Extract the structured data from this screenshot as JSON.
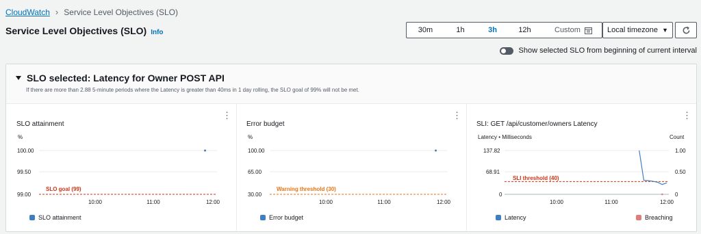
{
  "breadcrumb": {
    "root": "CloudWatch",
    "current": "Service Level Objectives (SLO)"
  },
  "header": {
    "title": "Service Level Objectives (SLO)",
    "info": "Info"
  },
  "time_range": {
    "options": [
      "30m",
      "1h",
      "3h",
      "12h"
    ],
    "active": "3h",
    "custom": "Custom",
    "timezone": "Local timezone"
  },
  "toggle": {
    "label": "Show selected SLO from beginning of current interval",
    "on": false
  },
  "slo": {
    "title": "SLO selected: Latency for Owner POST API",
    "description": "If there are more than 2.88 5-minute periods where the Latency is greater than 40ms in 1 day rolling, the SLO goal of 99% will not be met."
  },
  "panels": {
    "attainment": {
      "title": "SLO attainment",
      "unit": "%",
      "y_ticks": [
        "100.00",
        "99.50",
        "99.00"
      ],
      "x_ticks": [
        "10:00",
        "11:00",
        "12:00"
      ],
      "threshold_label": "SLO goal (99)",
      "legend": "SLO attainment"
    },
    "budget": {
      "title": "Error budget",
      "unit": "%",
      "y_ticks": [
        "100.00",
        "65.00",
        "30.00"
      ],
      "x_ticks": [
        "10:00",
        "11:00",
        "12:00"
      ],
      "threshold_label": "Warning threshold (30)",
      "legend": "Error budget"
    },
    "sli": {
      "title": "SLI: GET /api/customer/owners Latency",
      "left_unit": "Latency • Milliseconds",
      "right_unit": "Count",
      "y_ticks_left": [
        "137.82",
        "68.91",
        "0"
      ],
      "y_ticks_right": [
        "1.00",
        "0.50",
        "0"
      ],
      "x_ticks": [
        "10:00",
        "11:00",
        "12:00"
      ],
      "threshold_label": "SLI threshold (40)",
      "legend_latency": "Latency",
      "legend_breaching": "Breaching"
    }
  },
  "colors": {
    "link": "#0073bb",
    "series_blue": "#3f7fc1",
    "threshold_red": "#d13212",
    "threshold_orange": "#ec7211",
    "breaching": "#e07c7c"
  },
  "chart_data": [
    {
      "type": "scatter",
      "title": "SLO attainment",
      "ylabel": "%",
      "x": [
        "11:52"
      ],
      "values": [
        100.0
      ],
      "ylim": [
        99.0,
        100.0
      ],
      "x_ticks": [
        "10:00",
        "11:00",
        "12:00"
      ],
      "threshold": {
        "label": "SLO goal (99)",
        "value": 99
      },
      "series": [
        {
          "name": "SLO attainment",
          "x": [
            "11:52"
          ],
          "values": [
            100.0
          ]
        }
      ]
    },
    {
      "type": "scatter",
      "title": "Error budget",
      "ylabel": "%",
      "x": [
        "11:52"
      ],
      "values": [
        100.0
      ],
      "ylim": [
        30.0,
        100.0
      ],
      "x_ticks": [
        "10:00",
        "11:00",
        "12:00"
      ],
      "threshold": {
        "label": "Warning threshold (30)",
        "value": 30
      },
      "series": [
        {
          "name": "Error budget",
          "x": [
            "11:52"
          ],
          "values": [
            100.0
          ]
        }
      ]
    },
    {
      "type": "line",
      "title": "SLI: GET /api/customer/owners Latency",
      "ylabel": "Latency • Milliseconds",
      "y2label": "Count",
      "ylim": [
        0,
        137.82
      ],
      "y2lim": [
        0,
        1.0
      ],
      "x_ticks": [
        "10:00",
        "11:00",
        "12:00"
      ],
      "threshold": {
        "label": "SLI threshold (40)",
        "value": 40
      },
      "series": [
        {
          "name": "Latency",
          "x": [
            "11:30",
            "11:35",
            "11:40",
            "11:45",
            "11:50",
            "11:55",
            "12:00"
          ],
          "values": [
            137.8,
            44,
            43,
            41,
            38,
            31,
            36
          ]
        },
        {
          "name": "Breaching",
          "x": [
            "11:55"
          ],
          "values": [
            0
          ]
        }
      ]
    }
  ]
}
